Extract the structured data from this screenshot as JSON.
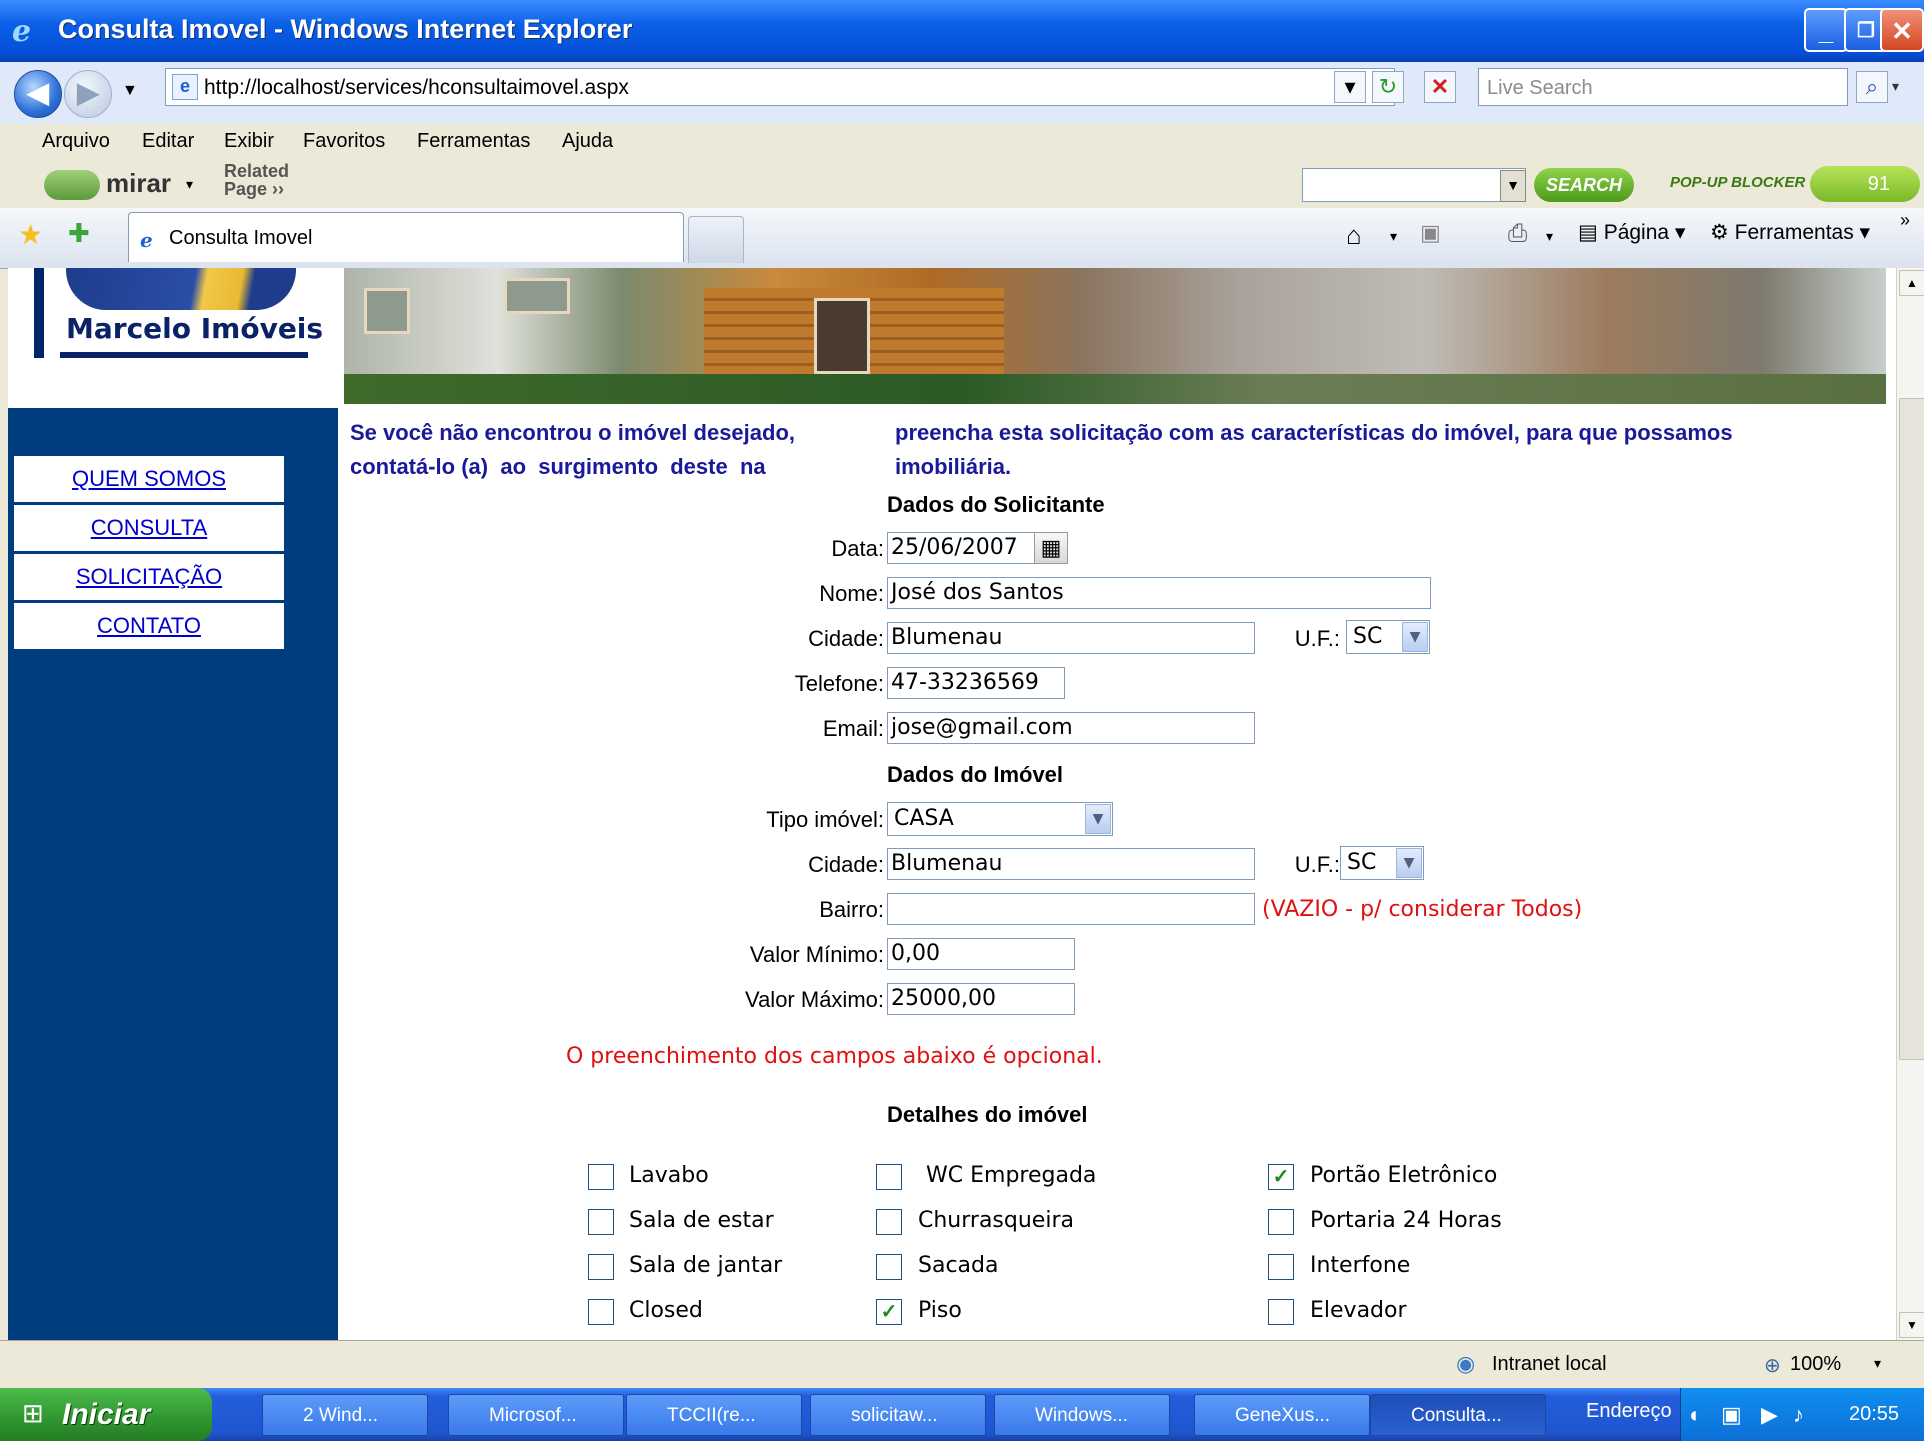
{
  "window": {
    "title": "Consulta Imovel - Windows Internet Explorer"
  },
  "address": {
    "url": "http://localhost/services/hconsultaimovel.aspx",
    "search_placeholder": "Live Search"
  },
  "menu": [
    "Arquivo",
    "Editar",
    "Exibir",
    "Favoritos",
    "Ferramentas",
    "Ajuda"
  ],
  "links": {
    "mirar": "mirar",
    "related_1": "Related",
    "related_2": "Page",
    "search_btn": "SEARCH",
    "popup": "POP-UP BLOCKER",
    "popup_count": "91"
  },
  "tab": {
    "title": "Consulta Imovel"
  },
  "commands": {
    "pagina": "Página",
    "ferramentas": "Ferramentas"
  },
  "site": {
    "brand": "Marcelo Imóveis"
  },
  "sidebar": {
    "items": [
      {
        "label": "QUEM SOMOS"
      },
      {
        "label": "CONSULTA"
      },
      {
        "label": "SOLICITAÇÃO"
      },
      {
        "label": "CONTATO"
      }
    ]
  },
  "intro": {
    "line1_a": "Se você não encontrou o imóvel desejado,",
    "line1_b": "preencha esta solicitação com as características do imóvel, para que possamos",
    "line2_a": "contatá-lo (a)  ao  surgimento  deste  na",
    "line2_b": "imobiliária."
  },
  "solicitante": {
    "heading": "Dados do Solicitante",
    "data_label": "Data:",
    "data_value": "25/06/2007",
    "nome_label": "Nome:",
    "nome_value": "José dos Santos",
    "cidade_label": "Cidade:",
    "cidade_value": "Blumenau",
    "uf_label": "U.F.:",
    "uf_value": "SC",
    "telefone_label": "Telefone:",
    "telefone_value": "47-33236569",
    "email_label": "Email:",
    "email_value": "jose@gmail.com"
  },
  "imovel": {
    "heading": "Dados do Imóvel",
    "tipo_label": "Tipo imóvel:",
    "tipo_value": "CASA",
    "cidade_label": "Cidade:",
    "cidade_value": "Blumenau",
    "uf_label": "U.F.:",
    "uf_value": "SC",
    "bairro_label": "Bairro:",
    "bairro_value": "",
    "bairro_note": "(VAZIO - p/ considerar Todos)",
    "valor_min_label": "Valor Mínimo:",
    "valor_min_value": "0,00",
    "valor_max_label": "Valor Máximo:",
    "valor_max_value": "25000,00"
  },
  "optional_note": "O preenchimento dos campos abaixo é opcional.",
  "detalhes": {
    "heading": "Detalhes do imóvel",
    "col1": [
      {
        "label": "Lavabo",
        "checked": false
      },
      {
        "label": "Sala de estar",
        "checked": false
      },
      {
        "label": "Sala de jantar",
        "checked": false
      },
      {
        "label": "Closed",
        "checked": false
      }
    ],
    "col2": [
      {
        "label": "WC Empregada",
        "checked": false
      },
      {
        "label": "Churrasqueira",
        "checked": false
      },
      {
        "label": "Sacada",
        "checked": false
      },
      {
        "label": "Piso",
        "checked": true
      }
    ],
    "col3": [
      {
        "label": "Portão Eletrônico",
        "checked": true
      },
      {
        "label": "Portaria 24 Horas",
        "checked": false
      },
      {
        "label": "Interfone",
        "checked": false
      },
      {
        "label": "Elevador",
        "checked": false
      }
    ]
  },
  "status": {
    "zone": "Intranet local",
    "zoom": "100%"
  },
  "taskbar": {
    "start": "Iniciar",
    "buttons": [
      "2 Wind...",
      "Microsof...",
      "TCCII(re...",
      "solicitaw...",
      "Windows...",
      "GeneXus...",
      "Consulta..."
    ],
    "endereco": "Endereço",
    "clock": "20:55"
  }
}
